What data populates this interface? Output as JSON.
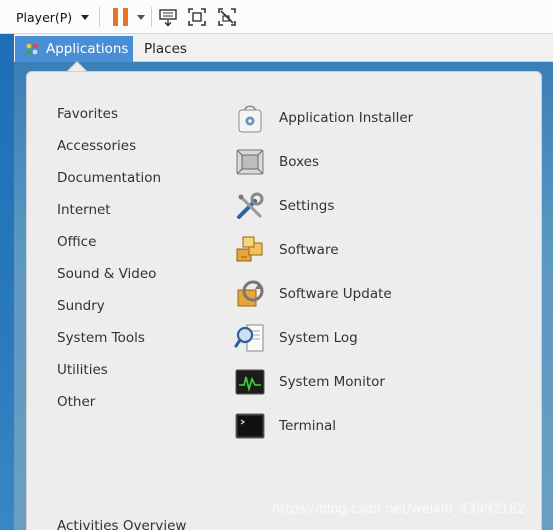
{
  "player_toolbar": {
    "menu_label": "Player(P)",
    "icons": [
      "pause-icon",
      "send-ctrl-alt-del-icon",
      "fit-guest-icon",
      "unity-mode-icon"
    ],
    "pause_color": "#e8742a"
  },
  "top_panel": {
    "applications_label": "Applications",
    "places_label": "Places",
    "active_color": "#4a8fd6"
  },
  "menu": {
    "categories": [
      "Favorites",
      "Accessories",
      "Documentation",
      "Internet",
      "Office",
      "Sound & Video",
      "Sundry",
      "System Tools",
      "Utilities",
      "Other"
    ],
    "apps": [
      {
        "label": "Application Installer",
        "icon": "app-installer-icon"
      },
      {
        "label": "Boxes",
        "icon": "boxes-icon"
      },
      {
        "label": "Settings",
        "icon": "settings-icon"
      },
      {
        "label": "Software",
        "icon": "software-icon"
      },
      {
        "label": "Software Update",
        "icon": "software-update-icon"
      },
      {
        "label": "System Log",
        "icon": "system-log-icon"
      },
      {
        "label": "System Monitor",
        "icon": "system-monitor-icon"
      },
      {
        "label": "Terminal",
        "icon": "terminal-icon"
      }
    ],
    "activities_label": "Activities Overview"
  },
  "watermark": "https://blog.csdn.net/weixin_43992162"
}
